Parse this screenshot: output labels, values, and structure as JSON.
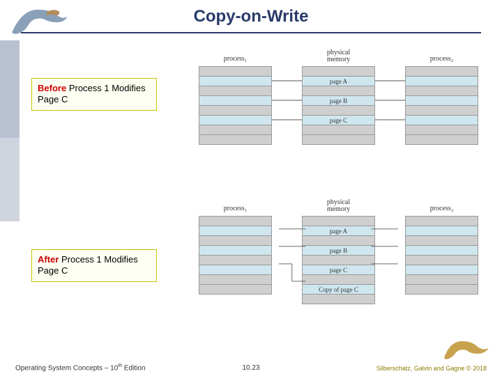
{
  "title": "Copy-on-Write",
  "callouts": {
    "before": {
      "keyword": "Before",
      "text": " Process 1 Modifies Page C"
    },
    "after": {
      "keyword": "After",
      "text": " Process 1 Modifies Page C"
    }
  },
  "figures": {
    "before": {
      "left_label": "process₁",
      "mid_label": "physical\nmemory",
      "right_label": "process₂",
      "pages": [
        "page A",
        "page B",
        "page C"
      ]
    },
    "after": {
      "left_label": "process₁",
      "mid_label": "physical\nmemory",
      "right_label": "process₂",
      "pages": [
        "page A",
        "page B",
        "page C",
        "Copy of page C"
      ]
    }
  },
  "footer": {
    "left_pre": "Operating System Concepts – 10",
    "left_sup": "th",
    "left_post": " Edition",
    "page": "10.23",
    "right": "Silberschatz, Galvin and Gagne © 2018"
  }
}
